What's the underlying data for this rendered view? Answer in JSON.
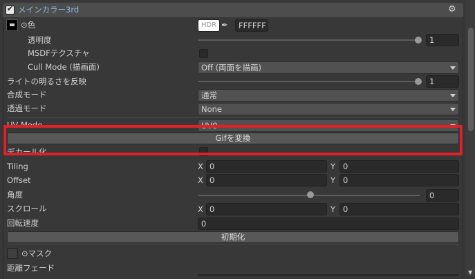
{
  "header": {
    "title": "メインカラー3rd",
    "enabled": true
  },
  "color": {
    "label": "⊙色",
    "hdr": "HDR",
    "hex": "FFFFFF"
  },
  "rows": {
    "alpha": {
      "label": "透明度",
      "value": "1",
      "fraction": 1.0
    },
    "msdf": {
      "label": "MSDFテクスチャ",
      "checked": false
    },
    "cull": {
      "label": "Cull Mode (描画面)",
      "value": "Off (両面を描画)"
    },
    "light": {
      "label": "ライトの明るさを反映",
      "value": "1",
      "fraction": 1.0
    },
    "blend": {
      "label": "合成モード",
      "value": "通常"
    },
    "alphamode": {
      "label": "透過モード",
      "value": "None"
    },
    "uv": {
      "label": "UV Mode",
      "value": "UV0"
    },
    "gif_button": "Gifを変換",
    "decal": {
      "label": "デカール化",
      "checked": false
    },
    "tiling": {
      "label": "Tiling",
      "x": "0",
      "y": "0"
    },
    "offset": {
      "label": "Offset",
      "x": "0",
      "y": "0"
    },
    "angle": {
      "label": "角度",
      "value": "0",
      "fraction": 0.5
    },
    "scroll": {
      "label": "スクロール",
      "x": "0",
      "y": "0"
    },
    "rotate": {
      "label": "回転速度",
      "value": "0"
    },
    "reset_button": "初期化",
    "mask": {
      "label": "⊙マスク"
    },
    "distfade": {
      "label": "距離フェード"
    }
  },
  "axis": {
    "x": "X",
    "y": "Y"
  },
  "colors": {
    "highlight": "#e0202a",
    "title": "#8fb3e0"
  }
}
